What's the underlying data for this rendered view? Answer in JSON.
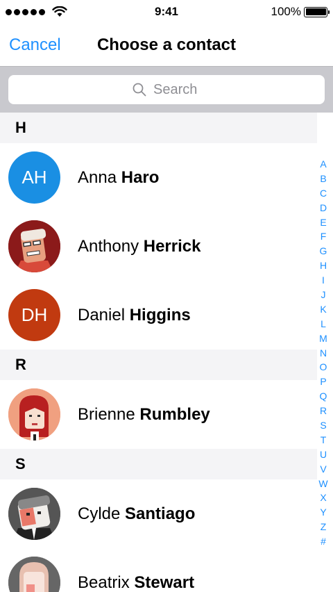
{
  "status": {
    "time": "9:41",
    "battery": "100%"
  },
  "nav": {
    "cancel": "Cancel",
    "title": "Choose a contact"
  },
  "search": {
    "placeholder": "Search"
  },
  "sections": [
    {
      "letter": "H",
      "contacts": [
        {
          "first": "Anna",
          "last": "Haro",
          "initials": "AH",
          "avatar": "initials",
          "color": "#1a8fe3"
        },
        {
          "first": "Anthony",
          "last": "Herrick",
          "initials": "",
          "avatar": "photo-red-face",
          "color": "#8b1a1a"
        },
        {
          "first": "Daniel",
          "last": "Higgins",
          "initials": "DH",
          "avatar": "initials",
          "color": "#c13a10"
        }
      ]
    },
    {
      "letter": "R",
      "contacts": [
        {
          "first": "Brienne",
          "last": "Rumbley",
          "initials": "",
          "avatar": "photo-redhair",
          "color": "#f0a080"
        }
      ]
    },
    {
      "letter": "S",
      "contacts": [
        {
          "first": "Cylde",
          "last": "Santiago",
          "initials": "",
          "avatar": "photo-gray-face",
          "color": "#555555"
        },
        {
          "first": "Beatrix",
          "last": "Stewart",
          "initials": "",
          "avatar": "photo-pink-face",
          "color": "#666666"
        }
      ]
    }
  ],
  "index": [
    "A",
    "B",
    "C",
    "D",
    "E",
    "F",
    "G",
    "H",
    "I",
    "J",
    "K",
    "L",
    "M",
    "N",
    "O",
    "P",
    "Q",
    "R",
    "S",
    "T",
    "U",
    "V",
    "W",
    "X",
    "Y",
    "Z",
    "#"
  ],
  "colors": {
    "accent": "#1e90ff",
    "section_bg": "#f4f4f6",
    "search_bg": "#c9c9ce"
  }
}
